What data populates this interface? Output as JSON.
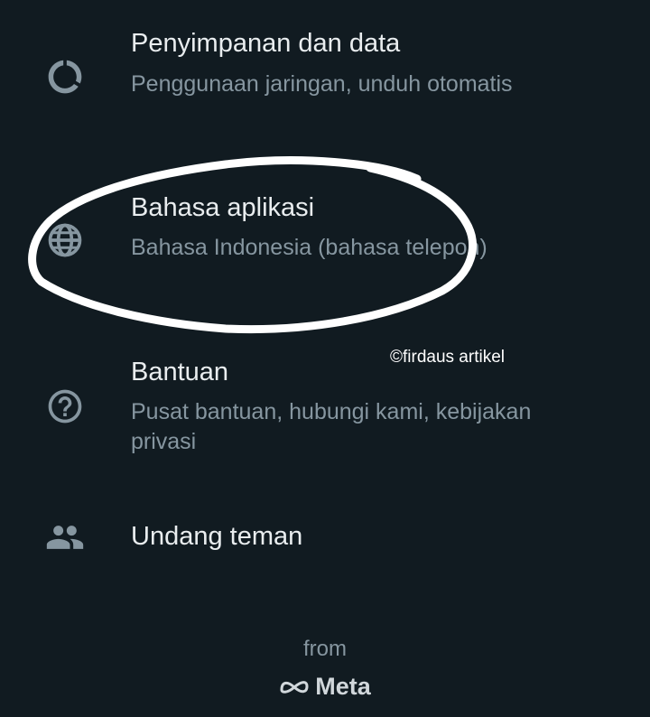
{
  "settings": {
    "items": [
      {
        "icon": "data-usage-icon",
        "title": "Penyimpanan dan data",
        "subtitle": "Penggunaan jaringan, unduh otomatis"
      },
      {
        "icon": "globe-icon",
        "title": "Bahasa aplikasi",
        "subtitle": "Bahasa Indonesia (bahasa telepon)"
      },
      {
        "icon": "help-icon",
        "title": "Bantuan",
        "subtitle": "Pusat bantuan, hubungi kami, kebijakan privasi"
      },
      {
        "icon": "invite-friends-icon",
        "title": "Undang teman"
      }
    ]
  },
  "watermark": "©firdaus artikel",
  "footer": {
    "from": "from",
    "brand": "Meta"
  },
  "colors": {
    "background": "#111b21",
    "title": "#e9edef",
    "subtitle": "#8696a0",
    "icon": "#8696a0",
    "annotation": "#ffffff"
  }
}
